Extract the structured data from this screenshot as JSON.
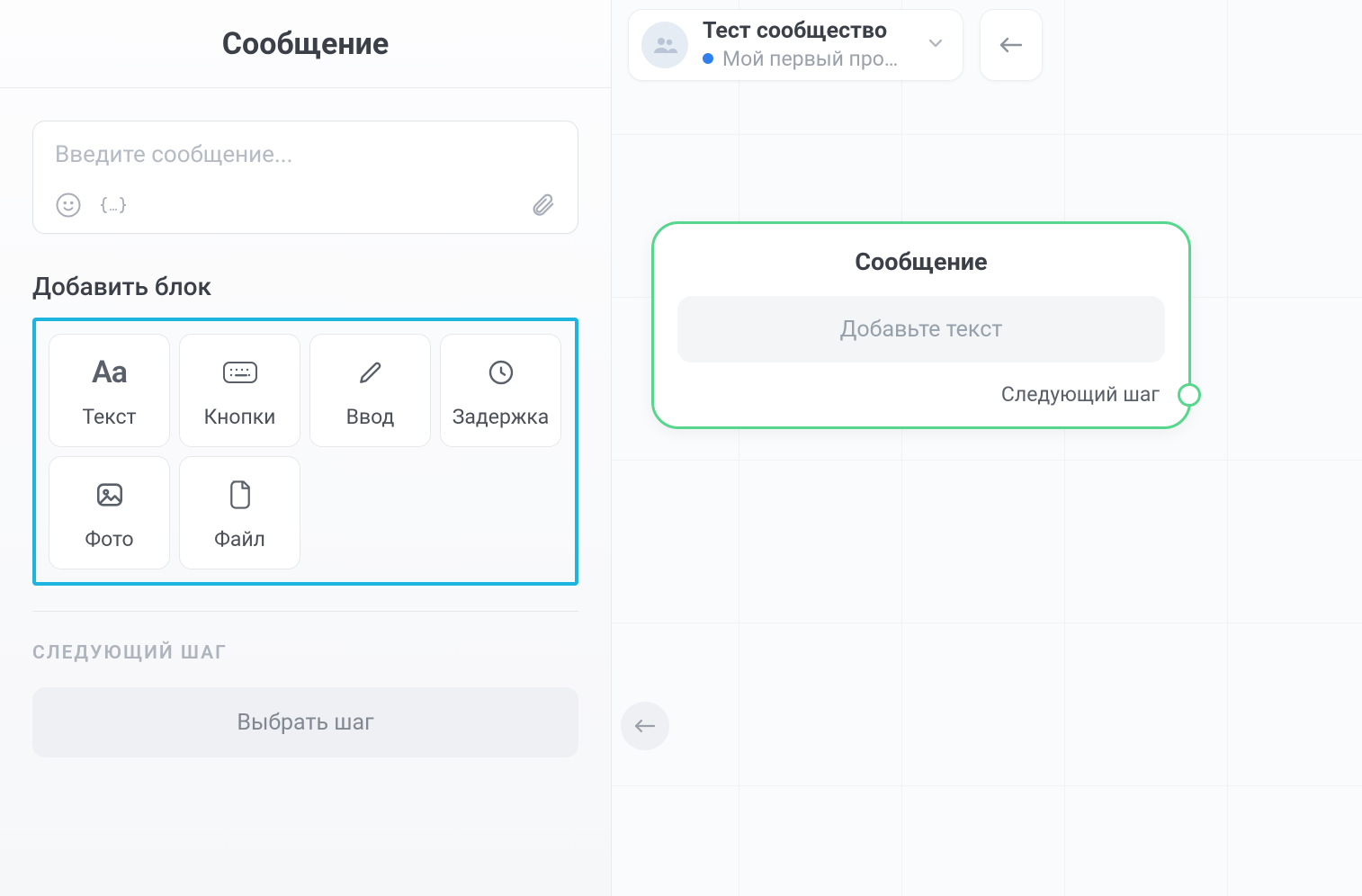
{
  "left": {
    "title": "Сообщение",
    "message_placeholder": "Введите сообщение...",
    "add_block_title": "Добавить блок",
    "blocks": {
      "text": "Текст",
      "buttons": "Кнопки",
      "input": "Ввод",
      "delay": "Задержка",
      "photo": "Фото",
      "file": "Файл"
    },
    "next_step_heading": "СЛЕДУЮЩИЙ ШАГ",
    "choose_step": "Выбрать шаг"
  },
  "top": {
    "community_title": "Тест сообщество",
    "project_name": "Мой первый про…"
  },
  "node": {
    "title": "Сообщение",
    "placeholder": "Добавьте текст",
    "next": "Следующий шаг"
  }
}
